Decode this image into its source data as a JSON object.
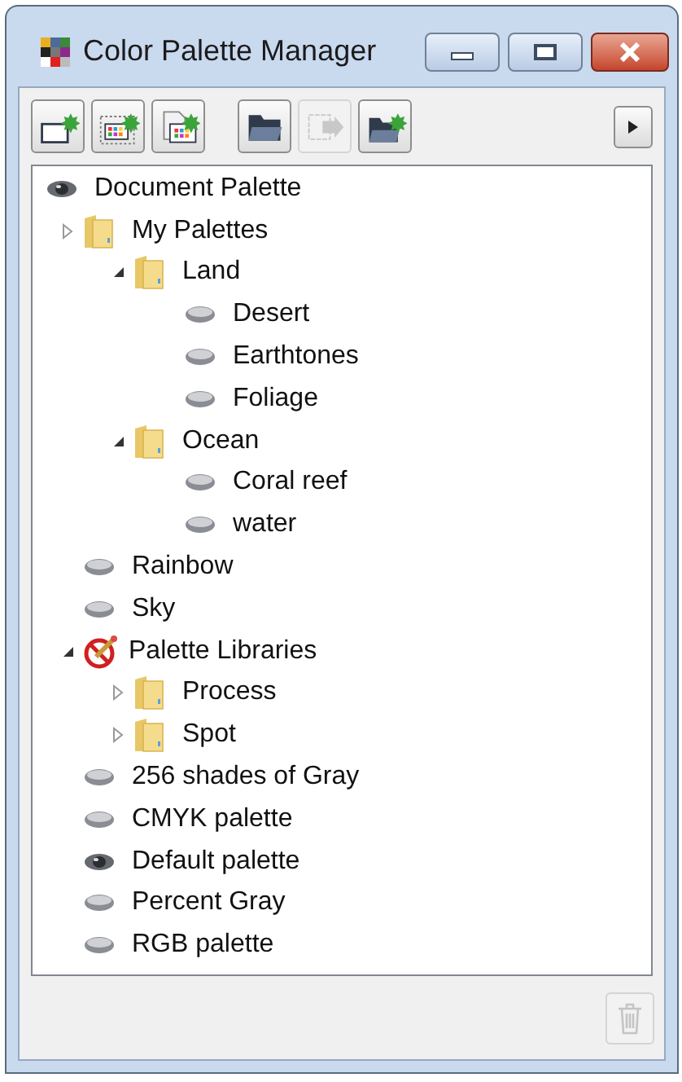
{
  "window": {
    "title": "Color Palette Manager"
  },
  "toolbar": [
    {
      "kind": "new-palette",
      "disabled": false
    },
    {
      "kind": "new-from-selection",
      "disabled": false
    },
    {
      "kind": "new-from-document",
      "disabled": false
    },
    {
      "kind": "open",
      "disabled": false
    },
    {
      "kind": "export",
      "disabled": true
    },
    {
      "kind": "new-folder",
      "disabled": false
    }
  ],
  "tree": [
    {
      "label": "Document Palette",
      "kind": "active",
      "children": [
        {
          "label": "My Palettes",
          "kind": "folder",
          "expanded": false,
          "children": [
            {
              "label": "Land",
              "kind": "folder",
              "expanded": true,
              "children": [
                {
                  "label": "Desert",
                  "kind": "palette"
                },
                {
                  "label": "Earthtones",
                  "kind": "palette"
                },
                {
                  "label": "Foliage",
                  "kind": "palette"
                }
              ]
            },
            {
              "label": "Ocean",
              "kind": "folder",
              "expanded": true,
              "children": [
                {
                  "label": "Coral reef",
                  "kind": "palette"
                },
                {
                  "label": "water",
                  "kind": "palette"
                }
              ]
            }
          ]
        },
        {
          "label": "Rainbow",
          "kind": "palette"
        },
        {
          "label": "Sky",
          "kind": "palette"
        },
        {
          "label": "Palette Libraries",
          "kind": "library",
          "expanded": true,
          "children": [
            {
              "label": "Process",
              "kind": "folder",
              "expanded": false
            },
            {
              "label": "Spot",
              "kind": "folder",
              "expanded": false
            }
          ]
        },
        {
          "label": "256 shades of Gray",
          "kind": "palette"
        },
        {
          "label": "CMYK palette",
          "kind": "palette"
        },
        {
          "label": "Default palette",
          "kind": "active"
        },
        {
          "label": "Percent Gray",
          "kind": "palette"
        },
        {
          "label": "RGB palette",
          "kind": "palette"
        }
      ]
    }
  ],
  "delete_button": {
    "disabled": true
  }
}
